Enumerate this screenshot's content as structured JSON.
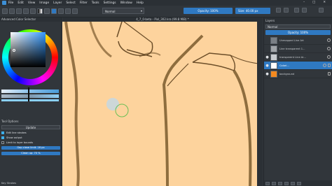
{
  "menu": {
    "items": [
      "File",
      "Edit",
      "View",
      "Image",
      "Layer",
      "Select",
      "Filter",
      "Tools",
      "Settings",
      "Window",
      "Help"
    ]
  },
  "window_controls": {
    "minimize": "–",
    "maximize": "□",
    "close": "✕"
  },
  "toolbar": {
    "blend_mode": "Normal",
    "opacity_label": "Opacity: 100%",
    "size_label": "Size: 40.00 px"
  },
  "left_docker": {
    "title": "Advanced Color Selector",
    "tool_options_title": "Tool Options",
    "mode": "Update",
    "options": [
      {
        "label": "Edit line strokes",
        "checked": true
      },
      {
        "label": "Show output",
        "checked": true
      },
      {
        "label": "Limit to layer bounds",
        "checked": false
      }
    ],
    "gap_label": "Gap close limit: 16 px",
    "cleanup_label": "Clean up: 70 %",
    "key_strokes": "Key Strokes"
  },
  "canvas": {
    "tab_title": "4_7_0-beta - Pixl_302.kra (99.8 MiB) *",
    "bg_color": "#fdd39d"
  },
  "right_docker": {
    "title": "Layers",
    "blend": "Normal",
    "opacity": "Opacity: 100%",
    "layers": [
      {
        "name": "Unmapped Line Art",
        "visible": false,
        "thumb": "#7a7f85",
        "active": false
      },
      {
        "name": "Line transparent 1...",
        "visible": false,
        "thumb": "#a0a4a8",
        "active": false
      },
      {
        "name": "transparent Line Ar...",
        "visible": true,
        "thumb": "#c8ccd0",
        "active": false
      },
      {
        "name": "Colori...",
        "visible": true,
        "thumb": "#ffffff",
        "active": true
      },
      {
        "name": "background",
        "visible": true,
        "thumb": "#f58a1f",
        "active": false
      }
    ]
  },
  "colors": {
    "accent": "#2f79c2",
    "ink": "#7a5a2e",
    "canvas_bg": "#fdd39d"
  }
}
